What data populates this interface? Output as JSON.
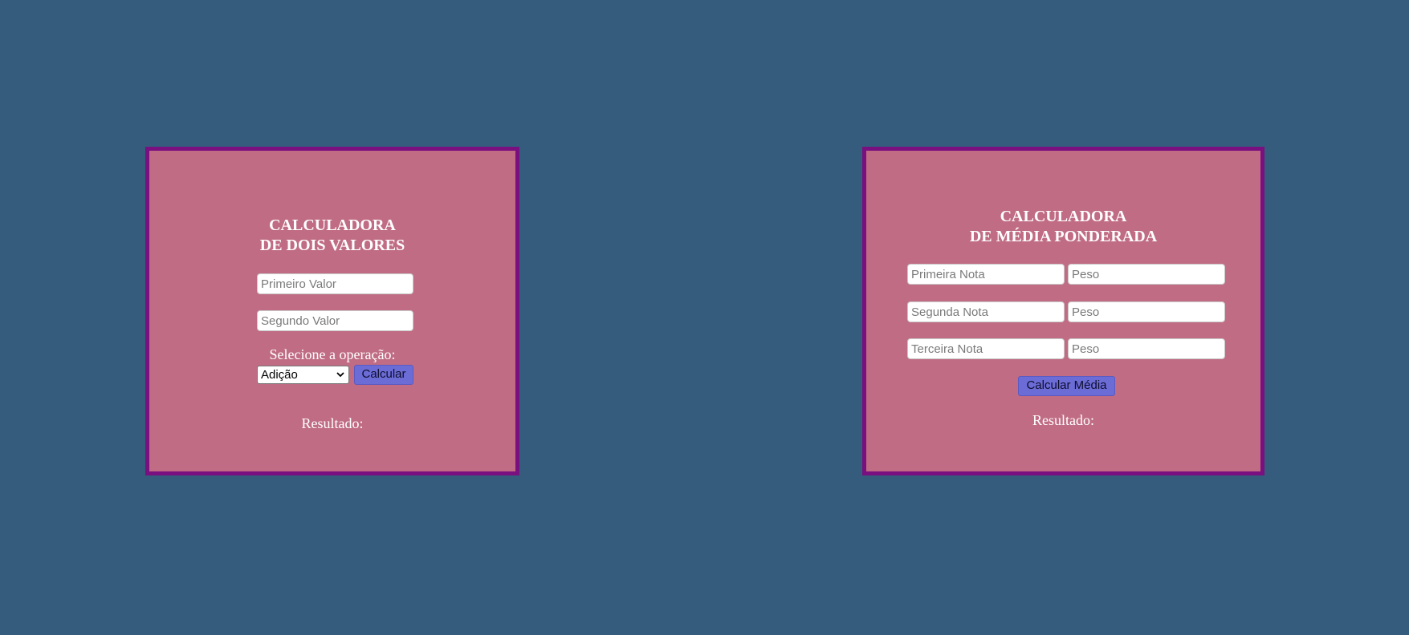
{
  "colors": {
    "background": "#355c7d",
    "panel": "#c06c84",
    "panel_border": "#7a0f80",
    "button": "#6c6cd6"
  },
  "calc_two_values": {
    "title_line1": "CALCULADORA",
    "title_line2": "DE DOIS VALORES",
    "first_value_placeholder": "Primeiro Valor",
    "second_value_placeholder": "Segundo Valor",
    "operation_label": "Selecione a operação:",
    "operation_selected": "Adição",
    "calculate_button": "Calcular",
    "result_label": "Resultado:"
  },
  "calc_weighted_avg": {
    "title_line1": "CALCULADORA",
    "title_line2": "DE MÉDIA PONDERADA",
    "rows": [
      {
        "grade_placeholder": "Primeira Nota",
        "weight_placeholder": "Peso"
      },
      {
        "grade_placeholder": "Segunda Nota",
        "weight_placeholder": "Peso"
      },
      {
        "grade_placeholder": "Terceira Nota",
        "weight_placeholder": "Peso"
      }
    ],
    "calculate_button": "Calcular Média",
    "result_label": "Resultado:"
  }
}
